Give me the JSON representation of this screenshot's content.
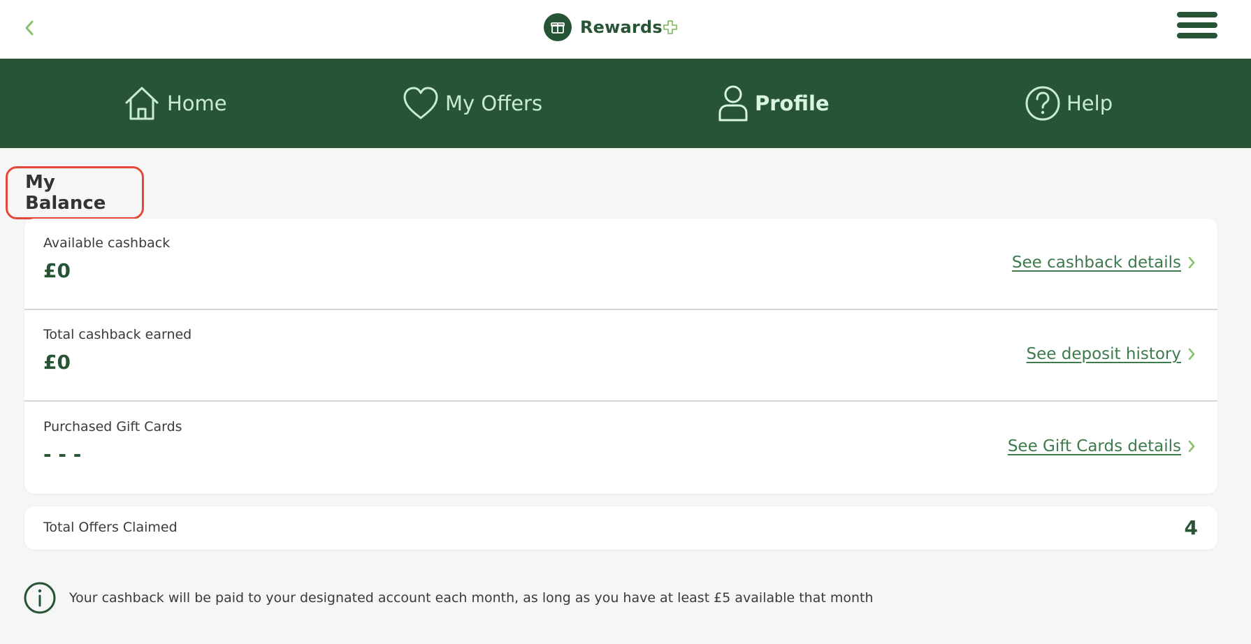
{
  "header": {
    "brand_name": "Rewards",
    "brand_suffix_icon": "plus-outline-icon",
    "back_icon": "chevron-left-icon",
    "menu_icon": "hamburger-menu-icon",
    "colors": {
      "brand_green": "#285436",
      "accent_green": "#8bbf6a",
      "highlight_red": "#e5483b"
    }
  },
  "nav": {
    "items": [
      {
        "label": "Home",
        "icon": "home-icon",
        "active": false
      },
      {
        "label": "My Offers",
        "icon": "heart-icon",
        "active": false
      },
      {
        "label": "Profile",
        "icon": "user-icon",
        "active": true
      },
      {
        "label": "Help",
        "icon": "help-icon",
        "active": false
      }
    ]
  },
  "balance": {
    "title": "My Balance",
    "rows": [
      {
        "label": "Available cashback",
        "value": "£0",
        "link": "See cashback details"
      },
      {
        "label": "Total cashback earned",
        "value": "£0",
        "link": "See deposit history"
      },
      {
        "label": "Purchased Gift Cards",
        "value": "- - -",
        "link": "See Gift Cards details"
      }
    ]
  },
  "offers": {
    "label": "Total Offers Claimed",
    "value": "4"
  },
  "info": {
    "icon": "info-circle-icon",
    "text": "Your cashback will be paid to your designated account each month, as long as you have at least £5 available that month"
  }
}
